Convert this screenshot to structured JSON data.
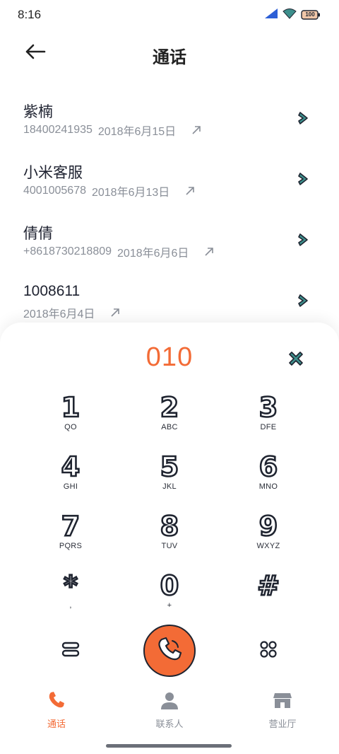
{
  "status_bar": {
    "time": "8:16",
    "battery": "100",
    "icons": [
      "signal-icon",
      "wifi-icon",
      "battery-icon"
    ]
  },
  "header": {
    "title": "通话",
    "back_icon": "arrow-left-icon"
  },
  "call_log": [
    {
      "name": "紫楠",
      "number": "18400241935",
      "date": "2018年6月15日",
      "direction_icon": "outgoing-arrow-icon"
    },
    {
      "name": "小米客服",
      "number": "4001005678",
      "date": "2018年6月13日",
      "direction_icon": "outgoing-arrow-icon"
    },
    {
      "name": "倩倩",
      "number": "+8618730218809",
      "date": "2018年6月6日",
      "direction_icon": "outgoing-arrow-icon"
    },
    {
      "name": "1008611",
      "number": "",
      "date": "2018年6月4日",
      "direction_icon": "outgoing-arrow-icon"
    }
  ],
  "dialer": {
    "input": "010",
    "keys": [
      {
        "digit": "1",
        "sub": "QO"
      },
      {
        "digit": "2",
        "sub": "ABC"
      },
      {
        "digit": "3",
        "sub": "DFE"
      },
      {
        "digit": "4",
        "sub": "GHI"
      },
      {
        "digit": "5",
        "sub": "JKL"
      },
      {
        "digit": "6",
        "sub": "MNO"
      },
      {
        "digit": "7",
        "sub": "PQRS"
      },
      {
        "digit": "8",
        "sub": "TUV"
      },
      {
        "digit": "9",
        "sub": "WXYZ"
      },
      {
        "digit": "*",
        "sub": ","
      },
      {
        "digit": "0",
        "sub": "+"
      },
      {
        "digit": "#",
        "sub": ""
      }
    ],
    "actions": [
      "menu-icon",
      "phone-icon",
      "grid-icon"
    ]
  },
  "bottom_nav": [
    {
      "label": "通话",
      "icon": "phone-icon",
      "active": true
    },
    {
      "label": "联系人",
      "icon": "person-icon",
      "active": false
    },
    {
      "label": "营业厅",
      "icon": "store-icon",
      "active": false
    }
  ],
  "colors": {
    "accent": "#f36b36",
    "teal": "#3d8f8c",
    "ink": "#1f2430",
    "muted": "#8a8f98"
  }
}
